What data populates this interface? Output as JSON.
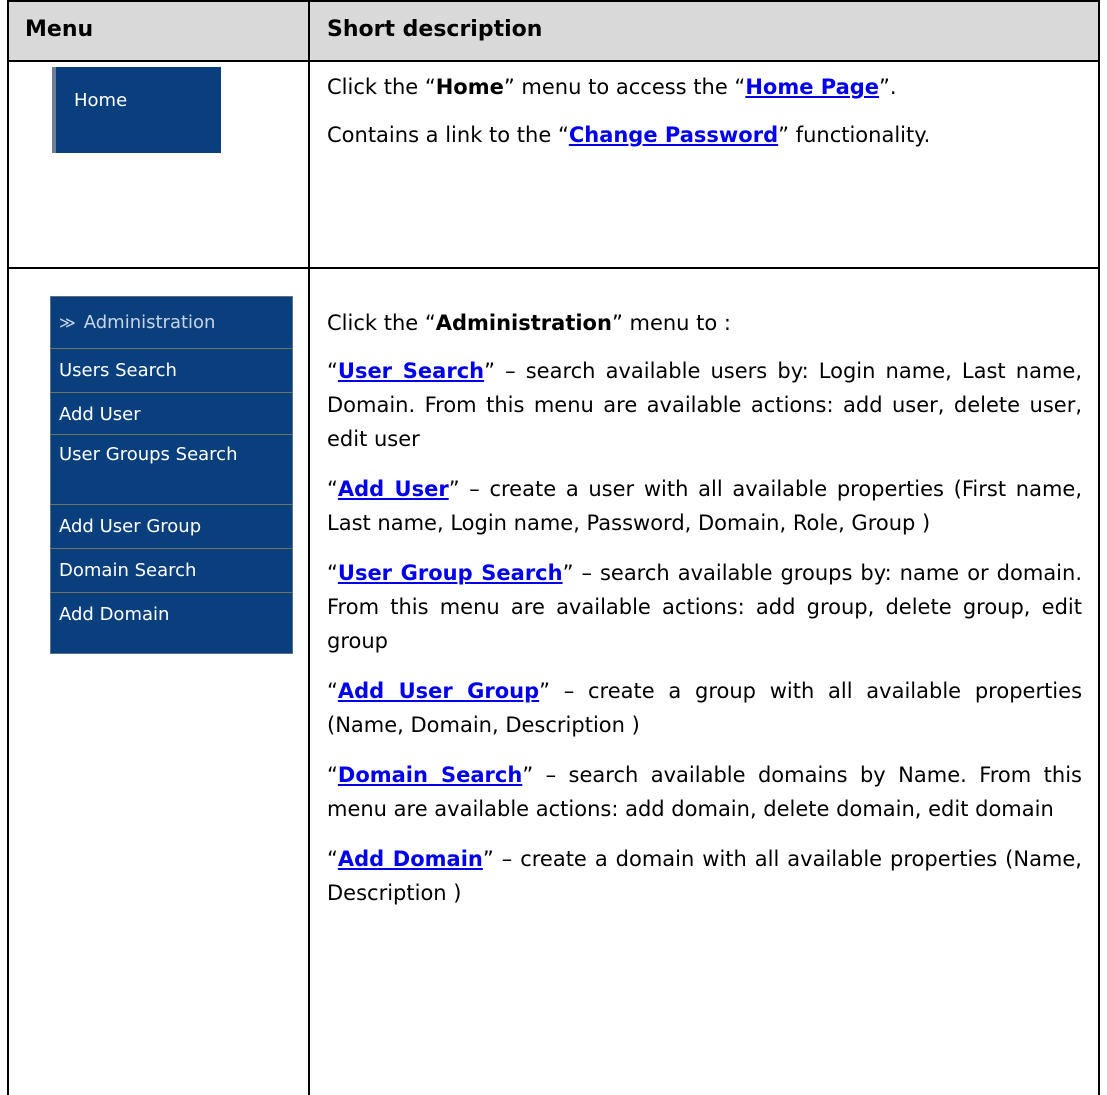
{
  "table": {
    "header": {
      "menu": "Menu",
      "description": "Short description"
    }
  },
  "home_menu": {
    "label": "Home"
  },
  "home_desc": {
    "p1_pre": "Click the “",
    "p1_bold": "Home",
    "p1_mid": "” menu to access the “",
    "p1_link": "Home Page",
    "p1_post": "”.",
    "p2_pre": "Contains a link to the “",
    "p2_link": "Change Password",
    "p2_post": "” functionality."
  },
  "admin_menu": {
    "head": "Administration",
    "items": [
      "Users Search",
      "Add User",
      "User Groups Search",
      "Add User Group",
      "Domain Search",
      "Add Domain"
    ]
  },
  "admin_desc": {
    "intro_pre": "Click the “",
    "intro_bold": "Administration",
    "intro_post": "” menu to :",
    "entries": [
      {
        "link": "User Search",
        "text": " – search available users by: Login name, Last name, Domain. From this menu are available actions: add user, delete user, edit user"
      },
      {
        "link": "Add User",
        "text": " – create a user with all available properties (First name, Last name, Login name, Password, Domain, Role, Group )"
      },
      {
        "link": "User Group Search",
        "text": " – search available groups by: name or domain. From this menu are available actions: add group, delete group, edit group"
      },
      {
        "link": "Add User Group",
        "text": " – create a group with all available properties (Name, Domain, Description )"
      },
      {
        "link": "Domain Search",
        "text": " – search available domains by Name. From this menu are available actions: add domain, delete domain, edit domain"
      },
      {
        "link": "Add Domain",
        "text": " – create a domain with all available properties (Name, Description )"
      }
    ]
  },
  "colors": {
    "menu_bg": "#0a3f7e",
    "link": "#0000ee",
    "header_bg": "#d9d9d9"
  }
}
